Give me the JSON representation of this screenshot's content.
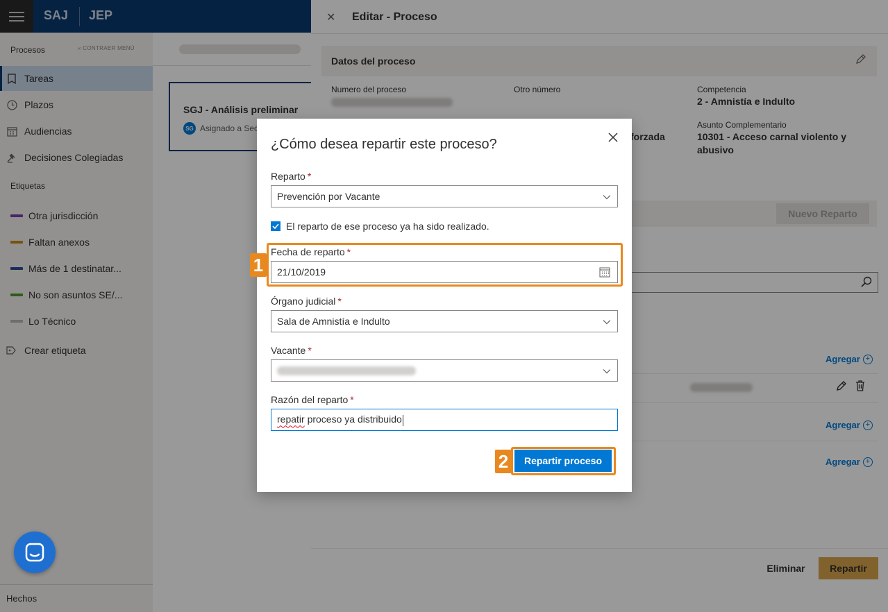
{
  "topbar": {
    "brand_primary": "SAJ",
    "brand_secondary": "JEP"
  },
  "sidebar": {
    "section_title": "Procesos",
    "collapse_label": "CONTRAER MENÚ",
    "items": [
      {
        "label": "Tareas",
        "icon": "bookmark-icon",
        "active": true
      },
      {
        "label": "Plazos",
        "icon": "clock-icon"
      },
      {
        "label": "Audiencias",
        "icon": "calendar-icon"
      },
      {
        "label": "Decisiones Colegiadas",
        "icon": "gavel-icon"
      }
    ],
    "tags_title": "Etiquetas",
    "tags": [
      {
        "label": "Otra jurisdicción",
        "color": "#7a3fb0"
      },
      {
        "label": "Faltan anexos",
        "color": "#c98a17"
      },
      {
        "label": "Más de 1 destinatar...",
        "color": "#2a4f8f"
      },
      {
        "label": "No son asuntos SE/...",
        "color": "#4f9a2e"
      },
      {
        "label": "Lo Técnico",
        "color": "#b8b8b8"
      }
    ],
    "create_tag": "Crear etiqueta",
    "footer": "Hechos"
  },
  "task_card": {
    "title": "SGJ - Análisis preliminar",
    "avatar": "SG",
    "subtitle": "Asignado a Sec"
  },
  "panel": {
    "title": "Editar - Proceso",
    "section_title": "Datos del proceso",
    "fields": {
      "numero_label": "Numero del proceso",
      "otro_label": "Otro número",
      "competencia_label": "Competencia",
      "competencia_value": "2 - Amnistía e Indulto",
      "asunto_label": "Asunto Complementario",
      "asunto_value": "10301 - Acceso carnal violento y abusivo",
      "partial_value": "forzada"
    },
    "nuevo_reparto": "Nuevo Reparto",
    "agregar": "Agregar",
    "eliminar": "Eliminar",
    "repartir": "Repartir"
  },
  "dialog": {
    "title": "¿Cómo desea repartir este proceso?",
    "reparto_label": "Reparto",
    "reparto_value": "Prevención por Vacante",
    "checkbox_label": "El reparto de ese proceso ya ha sido realizado.",
    "fecha_label": "Fecha de reparto",
    "fecha_value": "21/10/2019",
    "organo_label": "Órgano judicial",
    "organo_value": "Sala de Amnistía e Indulto",
    "vacante_label": "Vacante",
    "razon_label": "Razón del reparto",
    "razon_word1": "repatir",
    "razon_rest": " proceso ya distribuido",
    "submit": "Repartir proceso",
    "required_mark": "*"
  },
  "callouts": [
    "1",
    "2"
  ],
  "colors": {
    "brand": "#0b3a6e",
    "accent": "#0078d4",
    "highlight": "#e8891f",
    "repartir_btn": "#d9a44a"
  }
}
